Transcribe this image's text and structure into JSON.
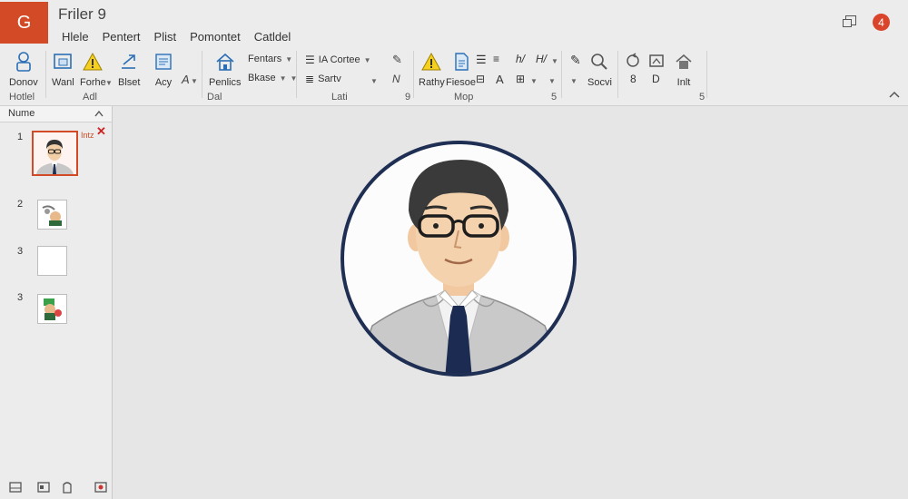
{
  "app": {
    "logo_letter": "G",
    "title": "Friler  9"
  },
  "menus": [
    "Hlele",
    "Pentert",
    "Plist",
    "Pomontet",
    "Catldel"
  ],
  "window": {
    "user_initial": "4",
    "accent": "#d24a26"
  },
  "ribbon": {
    "buttons": {
      "b1": "Donov",
      "b2": "Wanl",
      "b3": "Forhe",
      "b4": "Blset",
      "b5": "Acy",
      "b6": "Penlics",
      "b7": "Rathy",
      "b8": "Fiesoe",
      "b9": "Socvi",
      "b10": "Inlt"
    },
    "text_controls": {
      "fentars": "Fentars",
      "biase": "Bkase",
      "ia_cortee": "IA Cortee",
      "sartv": "Sartv",
      "letter_a": "A",
      "num_8": "8",
      "num_d": "D"
    },
    "groups": [
      "Hotlel",
      "Adl",
      "Dal",
      "Lati",
      "9",
      "Mop",
      "5",
      "5"
    ]
  },
  "left_panel": {
    "title": "Nume",
    "slide_numbers": [
      "1",
      "2",
      "3",
      "3"
    ],
    "thumb_tag": "Intz"
  }
}
